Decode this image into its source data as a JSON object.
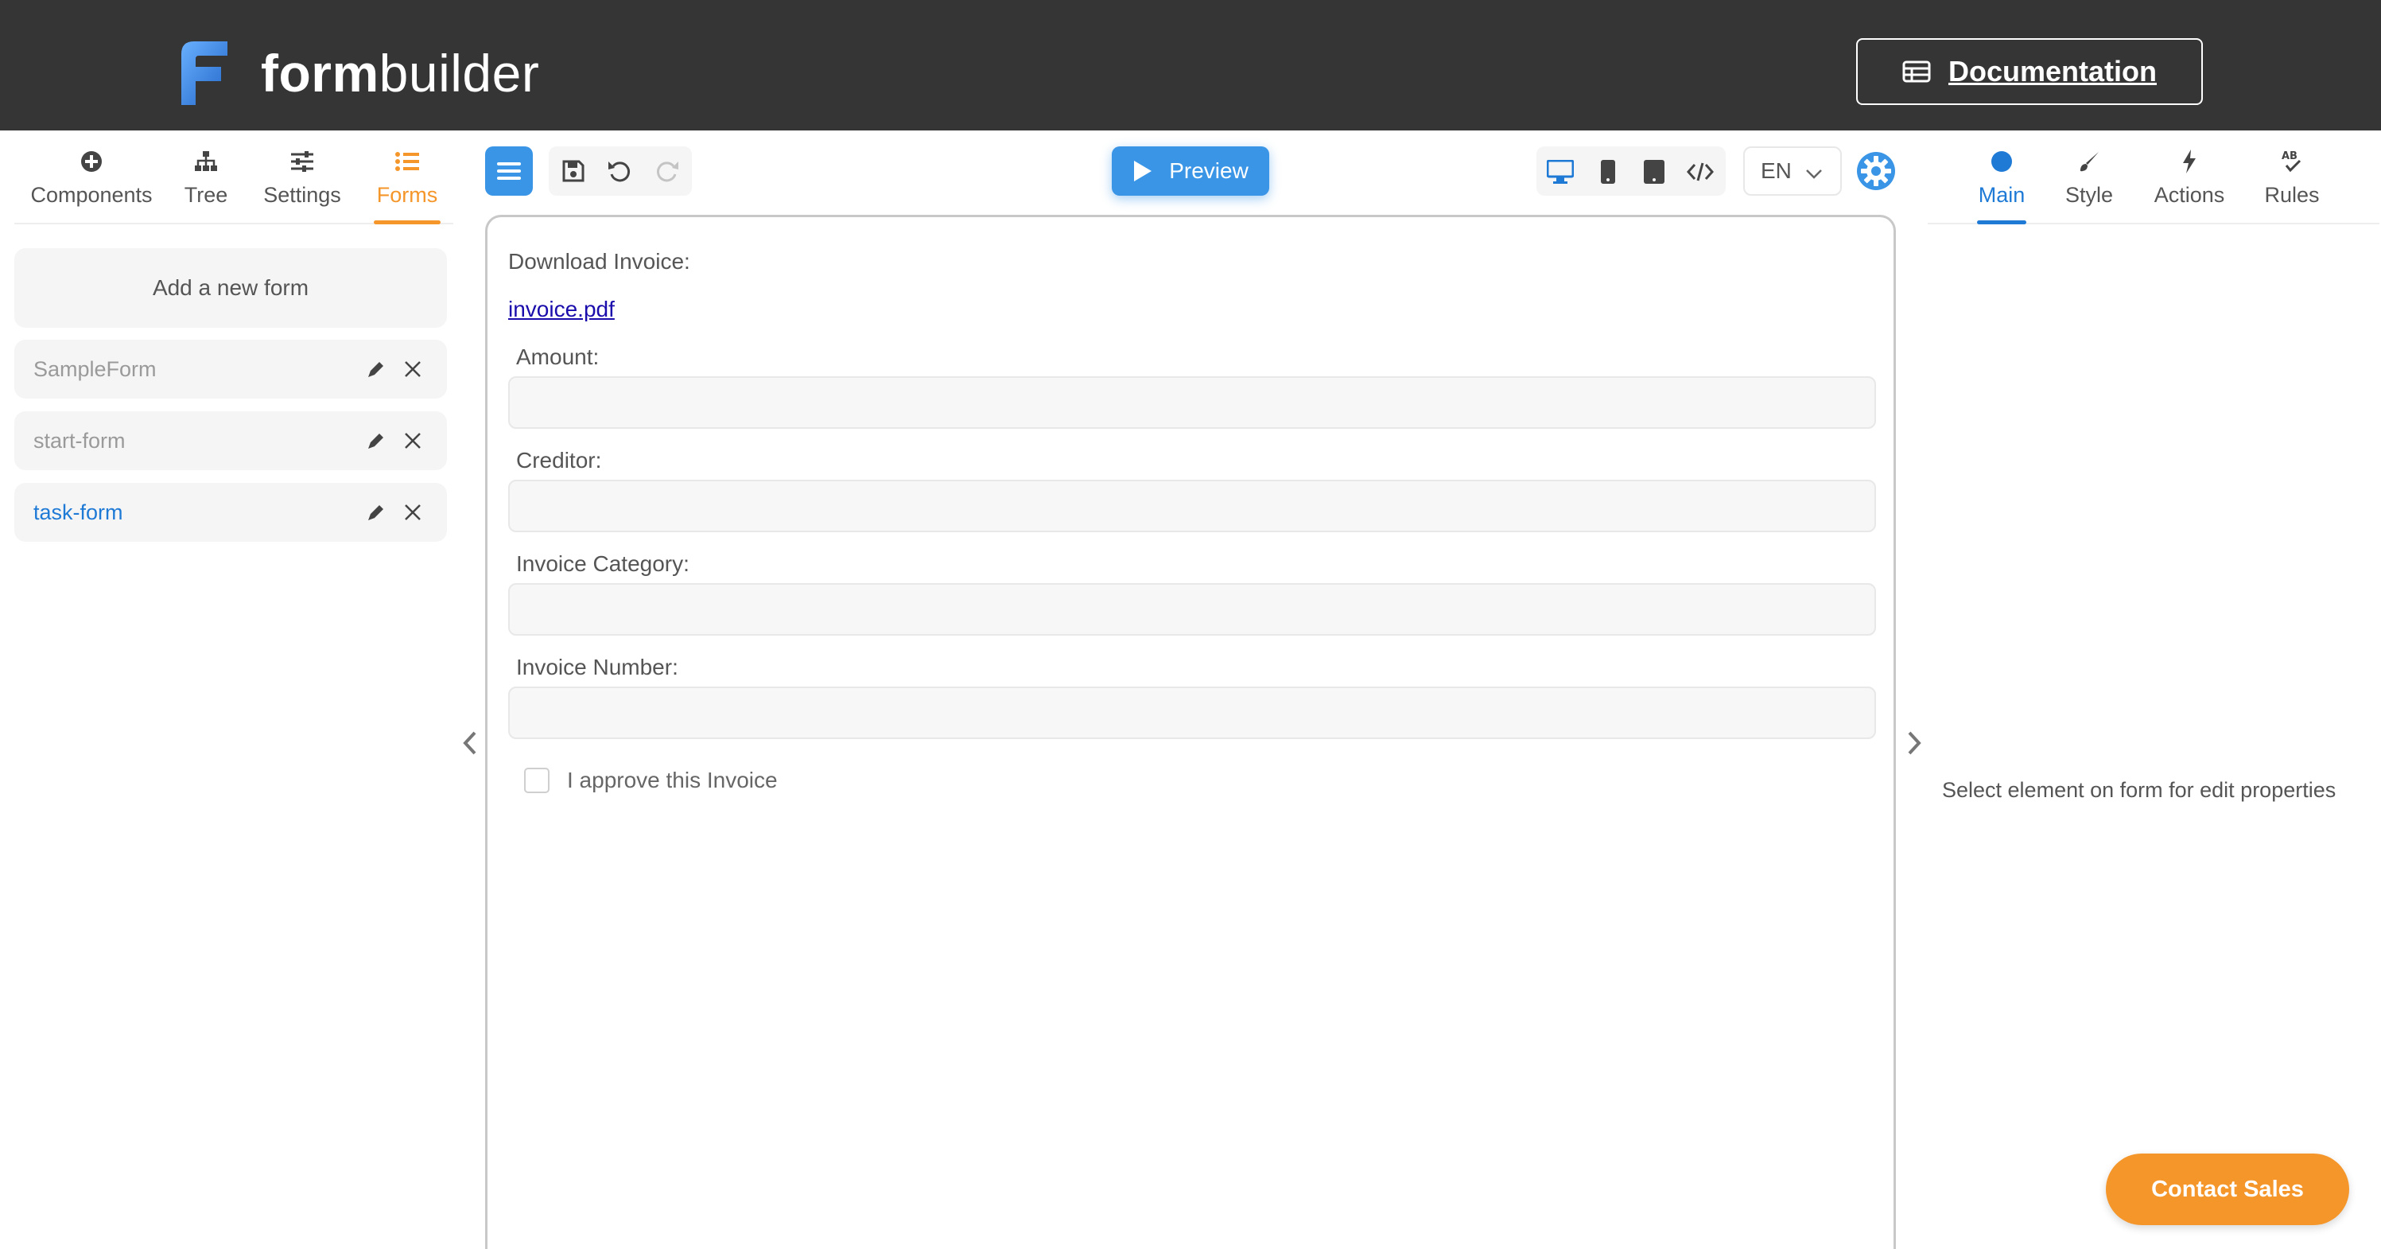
{
  "header": {
    "logo_bold": "form",
    "logo_light": "builder",
    "doc_label": "Documentation"
  },
  "left_tabs": [
    {
      "label": "Components",
      "icon": "plus-circle-icon"
    },
    {
      "label": "Tree",
      "icon": "sitemap-icon"
    },
    {
      "label": "Settings",
      "icon": "sliders-icon"
    },
    {
      "label": "Forms",
      "icon": "list-icon",
      "active": true
    }
  ],
  "forms": {
    "add_label": "Add a new form",
    "items": [
      {
        "name": "SampleForm"
      },
      {
        "name": "start-form"
      },
      {
        "name": "task-form",
        "active": true
      }
    ]
  },
  "toolbar": {
    "preview_label": "Preview",
    "language": "EN"
  },
  "canvas": {
    "download_label": "Download Invoice:",
    "download_link": "invoice.pdf",
    "fields": [
      {
        "label": "Amount:"
      },
      {
        "label": "Creditor:"
      },
      {
        "label": "Invoice Category:"
      },
      {
        "label": "Invoice Number:"
      }
    ],
    "checkbox_label": "I approve this Invoice"
  },
  "right_tabs": [
    {
      "label": "Main",
      "icon": "circle-icon",
      "active": true
    },
    {
      "label": "Style",
      "icon": "brush-icon"
    },
    {
      "label": "Actions",
      "icon": "bolt-icon"
    },
    {
      "label": "Rules",
      "icon": "ab-check-icon"
    }
  ],
  "right_panel": {
    "hint": "Select element on form for edit properties"
  },
  "contact_label": "Contact Sales",
  "colors": {
    "header_bg": "#353535",
    "accent_blue": "#3a95e6",
    "accent_orange": "#f5962a"
  }
}
